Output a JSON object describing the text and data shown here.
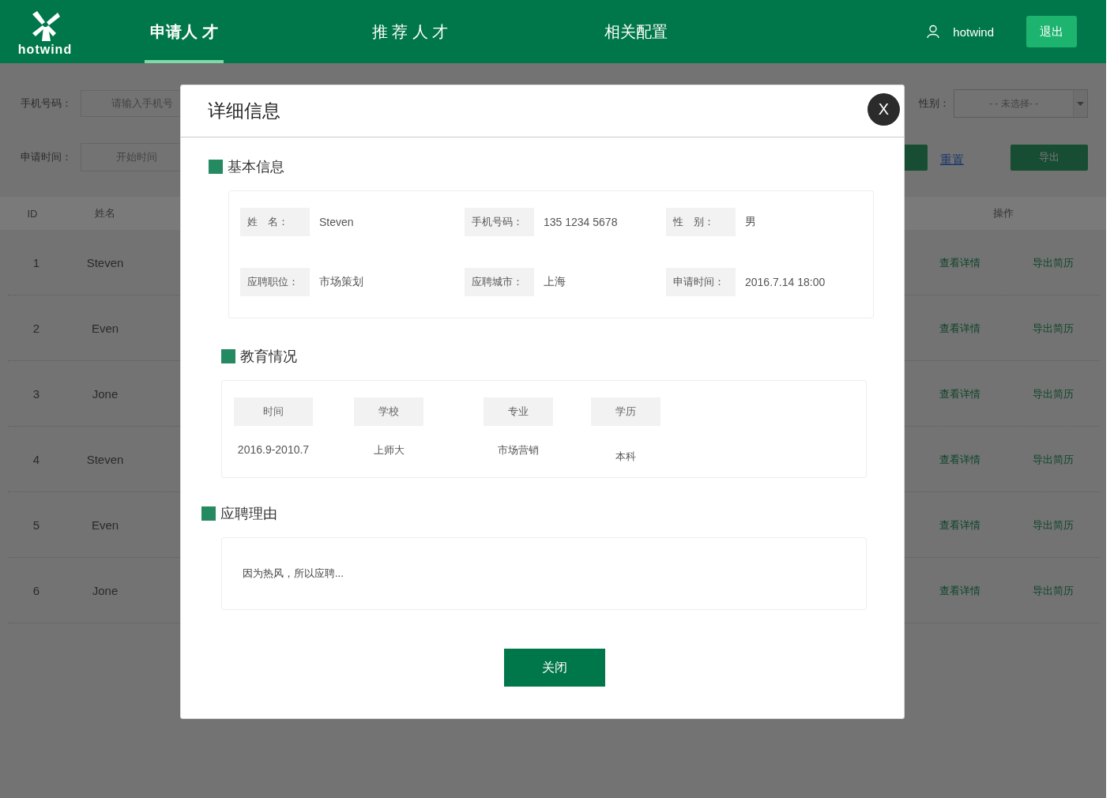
{
  "header": {
    "logo_text": "hotwind",
    "nav": [
      {
        "label": "申请人 才",
        "selected": true
      },
      {
        "label": "推 荐 人 才",
        "selected": false
      },
      {
        "label": "相关配置",
        "selected": false
      }
    ],
    "user": "hotwind",
    "logout": "退出"
  },
  "filters": {
    "phone": {
      "label": "手机号码：",
      "placeholder": "请输入手机号"
    },
    "date": {
      "label": "申请时间：",
      "placeholder": "开始时间"
    },
    "gender": {
      "label": "性别：",
      "placeholder": "- - 未选择- -"
    },
    "reset": "重置",
    "export": "导出"
  },
  "table": {
    "columns": [
      "ID",
      "姓名"
    ],
    "ops_column": "操作",
    "rows": [
      {
        "id": "1",
        "name": "Steven",
        "actions": [
          "查看详情",
          "导出简历"
        ]
      },
      {
        "id": "2",
        "name": "Even",
        "actions": [
          "查看详情",
          "导出简历"
        ]
      },
      {
        "id": "3",
        "name": "Jone",
        "actions": [
          "查看详情",
          "导出简历"
        ]
      },
      {
        "id": "4",
        "name": "Steven",
        "actions": [
          "查看详情",
          "导出简历"
        ]
      },
      {
        "id": "5",
        "name": "Even",
        "actions": [
          "查看详情",
          "导出简历"
        ]
      },
      {
        "id": "6",
        "name": "Jone",
        "actions": [
          "查看详情",
          "导出简历"
        ]
      }
    ]
  },
  "modal": {
    "title": "详细信息",
    "close": "X",
    "basic": {
      "heading": "基本信息",
      "fields": [
        {
          "label": "姓　名：",
          "value": "Steven"
        },
        {
          "label": "手机号码：",
          "value": "135 1234 5678"
        },
        {
          "label": "性　别：",
          "value": "男"
        },
        {
          "label": "应聘职位：",
          "value": "市场策划"
        },
        {
          "label": "应聘城市：",
          "value": "上海"
        },
        {
          "label": "申请时间：",
          "value": "2016.7.14 18:00"
        }
      ]
    },
    "education": {
      "heading": "教育情况",
      "columns": [
        "时间",
        "学校",
        "专业",
        "学历"
      ],
      "rows": [
        [
          "2016.9-2010.7",
          "上师大",
          "市场营销",
          "本科"
        ]
      ]
    },
    "reason": {
      "heading": "应聘理由",
      "text": "因为热风，所以应聘..."
    },
    "close_button": "关闭"
  }
}
